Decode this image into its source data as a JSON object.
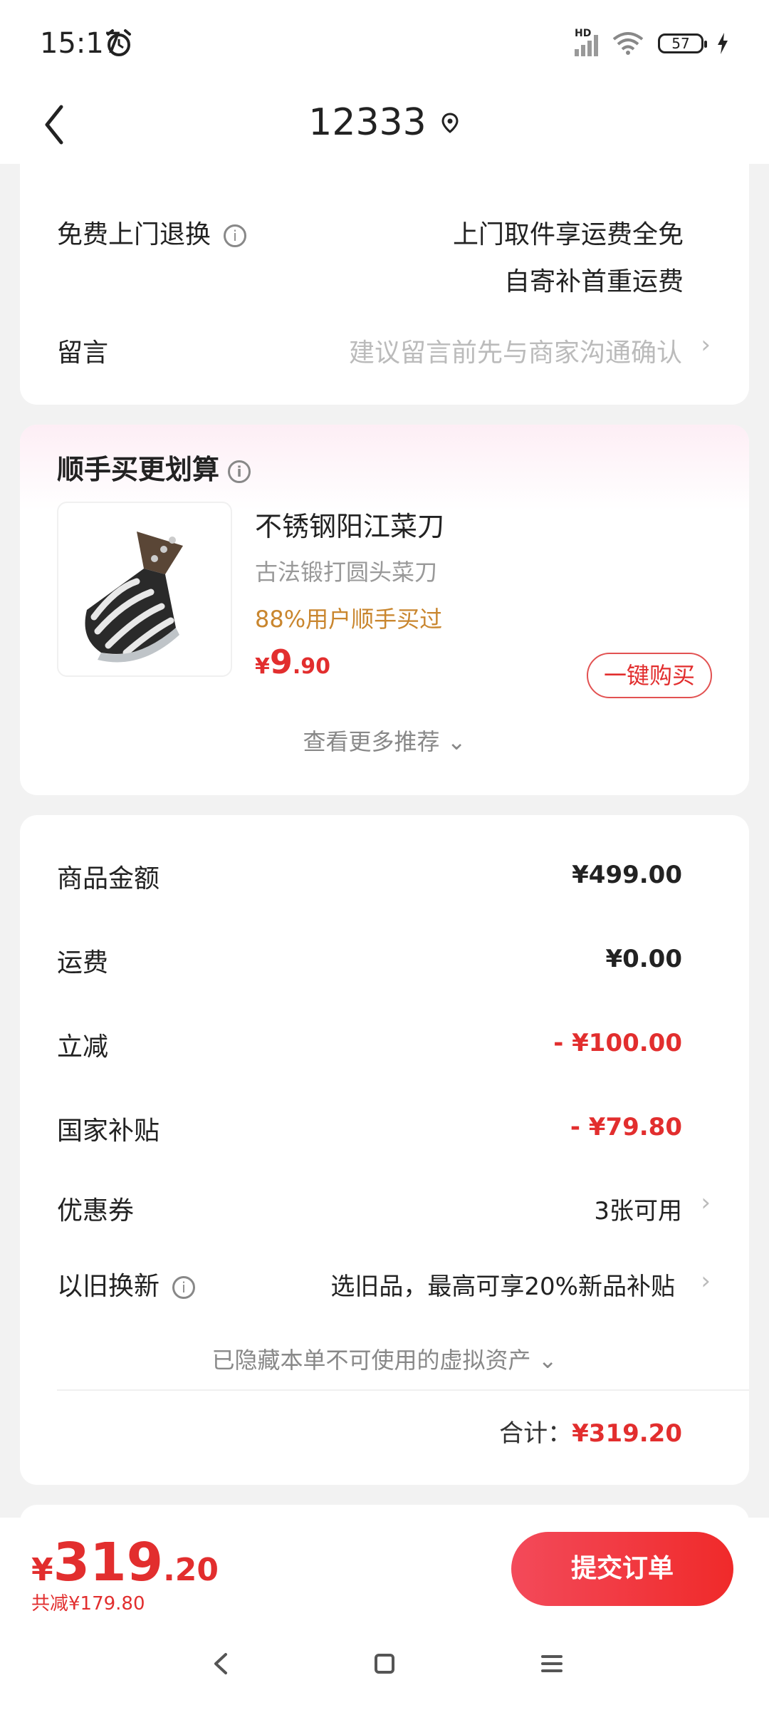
{
  "status_bar": {
    "time": "15:17",
    "network": "HD",
    "battery": "57"
  },
  "nav": {
    "title": "12333"
  },
  "service_card": {
    "return_label": "免费上门退换",
    "return_desc_line1": "上门取件享运费全免",
    "return_desc_line2": "自寄补首重运费",
    "message_label": "留言",
    "message_placeholder": "建议留言前先与商家沟通确认"
  },
  "addon_card": {
    "title": "顺手买更划算",
    "product_name": "不锈钢阳江菜刀",
    "product_sub": "古法锻打圆头菜刀",
    "buy_rate": "88%用户顺手买过",
    "price_currency": "¥",
    "price_int": "9",
    "price_dec": ".90",
    "one_click_label": "一键购买",
    "more_label": "查看更多推荐"
  },
  "amount_card": {
    "goods_label": "商品金额",
    "goods_value": "¥499.00",
    "shipping_label": "运费",
    "shipping_value": "¥0.00",
    "discount_label": "立减",
    "discount_value": "- ¥100.00",
    "subsidy_label": "国家补贴",
    "subsidy_value": "- ¥79.80",
    "coupon_label": "优惠券",
    "coupon_value": "3张可用",
    "tradein_label": "以旧换新",
    "tradein_value": "选旧品，最高可享20%新品补贴",
    "hidden_note": "已隐藏本单不可使用的虚拟资产",
    "total_label": "合计：",
    "total_value": "¥319.20"
  },
  "bottom_bar": {
    "price_currency": "¥",
    "price_int": "319",
    "price_dec": ".20",
    "saved": "共减¥179.80",
    "submit_label": "提交订单"
  },
  "colors": {
    "accent": "#e22e2e",
    "orange": "#c9862e"
  }
}
